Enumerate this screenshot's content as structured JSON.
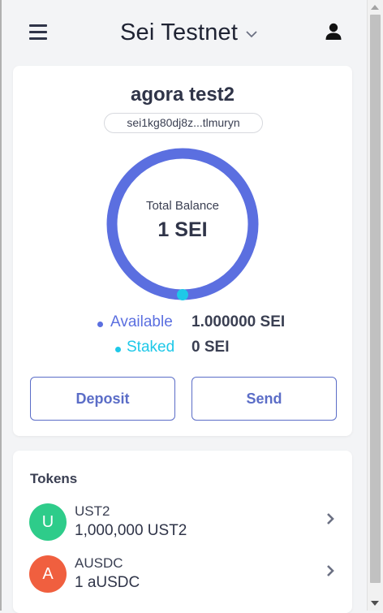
{
  "header": {
    "network": "Sei Testnet",
    "menu_icon": "hamburger-menu-icon",
    "account_icon": "user-icon",
    "dropdown_icon": "chevron-down-icon"
  },
  "wallet": {
    "account_name": "agora test2",
    "address": "sei1kg80dj8z...tlmuryn",
    "balance_label": "Total Balance",
    "balance_value": "1 SEI",
    "available_label": "Available",
    "available_value": "1.000000 SEI",
    "staked_label": "Staked",
    "staked_value": "0 SEI",
    "available_fraction": 1.0,
    "deposit_label": "Deposit",
    "send_label": "Send"
  },
  "tokens": {
    "title": "Tokens",
    "items": [
      {
        "initial": "U",
        "symbol": "UST2",
        "amount": "1,000,000 UST2",
        "color": "#2ecc8a"
      },
      {
        "initial": "A",
        "symbol": "AUSDC",
        "amount": "1 aUSDC",
        "color": "#f05f3f"
      }
    ]
  },
  "colors": {
    "available": "#5b6fe0",
    "staked": "#1ec8e8",
    "accent": "#5b6dc7"
  }
}
